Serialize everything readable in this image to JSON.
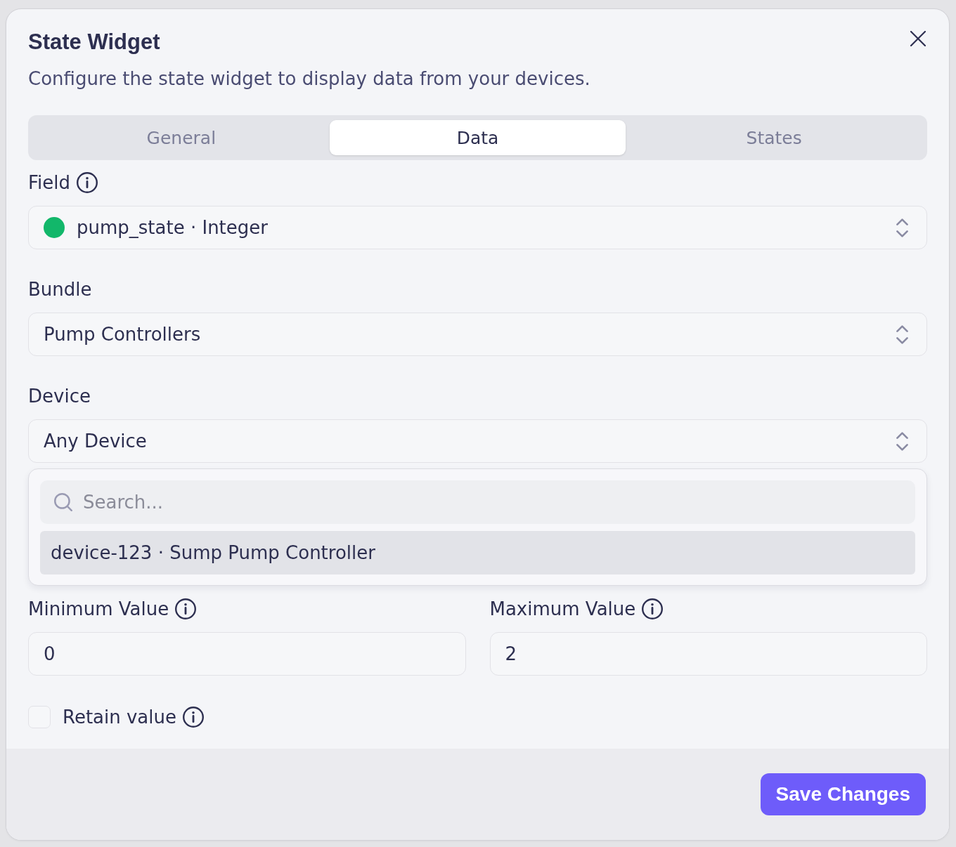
{
  "dialog": {
    "title": "State Widget",
    "description": "Configure the state widget to display data from your devices."
  },
  "tabs": [
    {
      "label": "General",
      "selected": false
    },
    {
      "label": "Data",
      "selected": true
    },
    {
      "label": "States",
      "selected": false
    }
  ],
  "form": [
    {
      "kind": "select",
      "label": "Field",
      "info": true,
      "value": "pump_state · Integer",
      "color": "#12b76a"
    },
    {
      "kind": "select",
      "label": "Bundle",
      "value": "Pump Controllers"
    },
    {
      "kind": "select",
      "label": "Device",
      "value": "Any Device",
      "menu": {
        "search_placeholder": "Search...",
        "options": [
          {
            "label": "device-123 · Sump Pump Controller",
            "selected": true
          }
        ]
      }
    }
  ],
  "range": [
    {
      "label": "Minimum Value",
      "info": true,
      "value": "0"
    },
    {
      "label": "Maximum Value",
      "info": true,
      "value": "2"
    }
  ],
  "retain": {
    "label": "Retain value",
    "info": true,
    "checked": false
  },
  "footer": {
    "button": "Save Changes"
  }
}
